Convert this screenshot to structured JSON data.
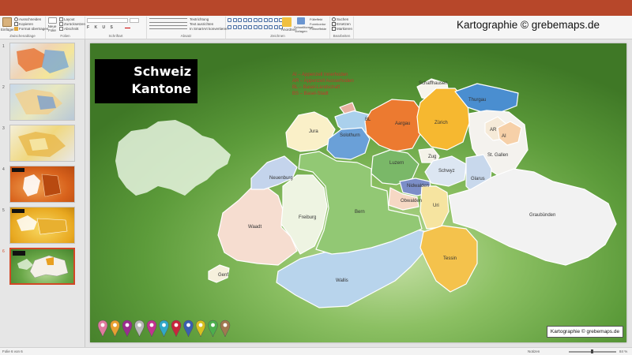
{
  "brand": "Kartographie © grebemaps.de",
  "ribbon": {
    "clipboard": {
      "group": "Zwischenablage",
      "paste": "Einfügen",
      "cut": "Ausschneiden",
      "copy": "Kopieren",
      "format_painter": "Format übertragen"
    },
    "slides": {
      "group": "Folien",
      "new_slide": "Neue Folie",
      "layout": "Layout",
      "reset": "Zurücksetzen",
      "section": "Abschnitt"
    },
    "font": {
      "group": "Schriftart"
    },
    "paragraph": {
      "group": "Absatz",
      "text_direction": "Textrichtung",
      "align_text": "Text ausrichten",
      "smartart": "In SmartArt konvertieren"
    },
    "drawing": {
      "group": "Zeichnen",
      "arrange": "Anordnen",
      "quick_styles": "Schnellformat-vorlagen",
      "shape_fill": "Fülleffekt",
      "shape_outline": "Formkontur",
      "shape_effects": "Formeffekte"
    },
    "editing": {
      "group": "Bearbeiten",
      "find": "Suchen",
      "replace": "Ersetzen",
      "select": "Markieren"
    }
  },
  "thumbnails": [
    {
      "num": "1",
      "selected": false
    },
    {
      "num": "2",
      "selected": false
    },
    {
      "num": "3",
      "selected": false
    },
    {
      "num": "4",
      "selected": false
    },
    {
      "num": "5",
      "selected": false
    },
    {
      "num": "6",
      "selected": true
    }
  ],
  "slide": {
    "title_line1": "Schweiz",
    "title_line2": "Kantone",
    "legend": [
      "AI – Appenzell Innerhoden",
      "AR – Appenzell Ausserhoden",
      "BL – Basel-Landschaft",
      "BS – Basel-Stadt"
    ],
    "credit": "Kartographie © grebemaps.de",
    "cantons": {
      "jura": "Jura",
      "bl": "BL",
      "solothurn": "Solothurn",
      "aargau": "Aargau",
      "zurich": "Zürich",
      "schaffhausen": "Schaffhausen",
      "thurgau": "Thurgau",
      "ar": "AR",
      "ai": "AI",
      "st_gallen": "St. Gallen",
      "zug": "Zug",
      "schwyz": "Schwyz",
      "glarus": "Glarus",
      "luzern": "Luzern",
      "nidwalden": "Nidwalden",
      "obwalden": "Obwalden",
      "uri": "Uri",
      "graubunden": "Graubünden",
      "tessin": "Tessin",
      "neuenburg": "Neuenburg",
      "freiburg": "Freiburg",
      "bern": "Bern",
      "waadt": "Waadt",
      "genf": "Genf",
      "wallis": "Wallis"
    },
    "pin_colors": [
      "#e07a9e",
      "#e8a030",
      "#9b2d8f",
      "#b8b8b8",
      "#c2338f",
      "#30a8c8",
      "#c8253c",
      "#3a5fb0",
      "#d8c020",
      "#4cae4c",
      "#a07850"
    ]
  },
  "status": {
    "slide_info": "Folie 6 von 6",
    "notes": "Notizen",
    "zoom": "84 %"
  }
}
